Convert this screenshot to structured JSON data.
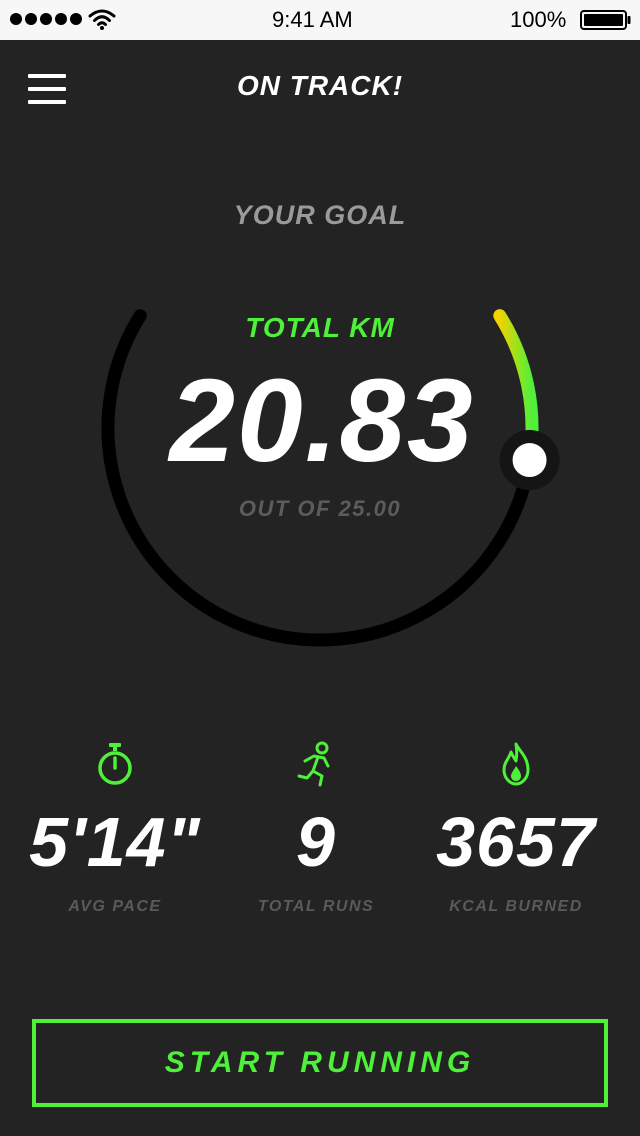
{
  "status_bar": {
    "time": "9:41 AM",
    "battery": "100%"
  },
  "header": {
    "title": "ON TRACK!",
    "menu_icon": "hamburger-icon"
  },
  "goal": {
    "label": "YOUR GOAL",
    "metric_label": "TOTAL KM",
    "value": "20.83",
    "subtitle": "OUT OF 25.00",
    "progress": 0.8332,
    "colors": {
      "start": "#f0d400",
      "end": "#4ef03a",
      "track": "#000000",
      "knob": "#ffffff"
    }
  },
  "stats": [
    {
      "icon": "stopwatch-icon",
      "value": "5'14\"",
      "label": "AVG PACE"
    },
    {
      "icon": "runner-icon",
      "value": "9",
      "label": "TOTAL RUNS"
    },
    {
      "icon": "flame-icon",
      "value": "3657",
      "label": "KCAL BURNED"
    }
  ],
  "cta": {
    "label": "START RUNNING"
  },
  "colors": {
    "accent": "#4ef03a",
    "background": "#232323"
  }
}
